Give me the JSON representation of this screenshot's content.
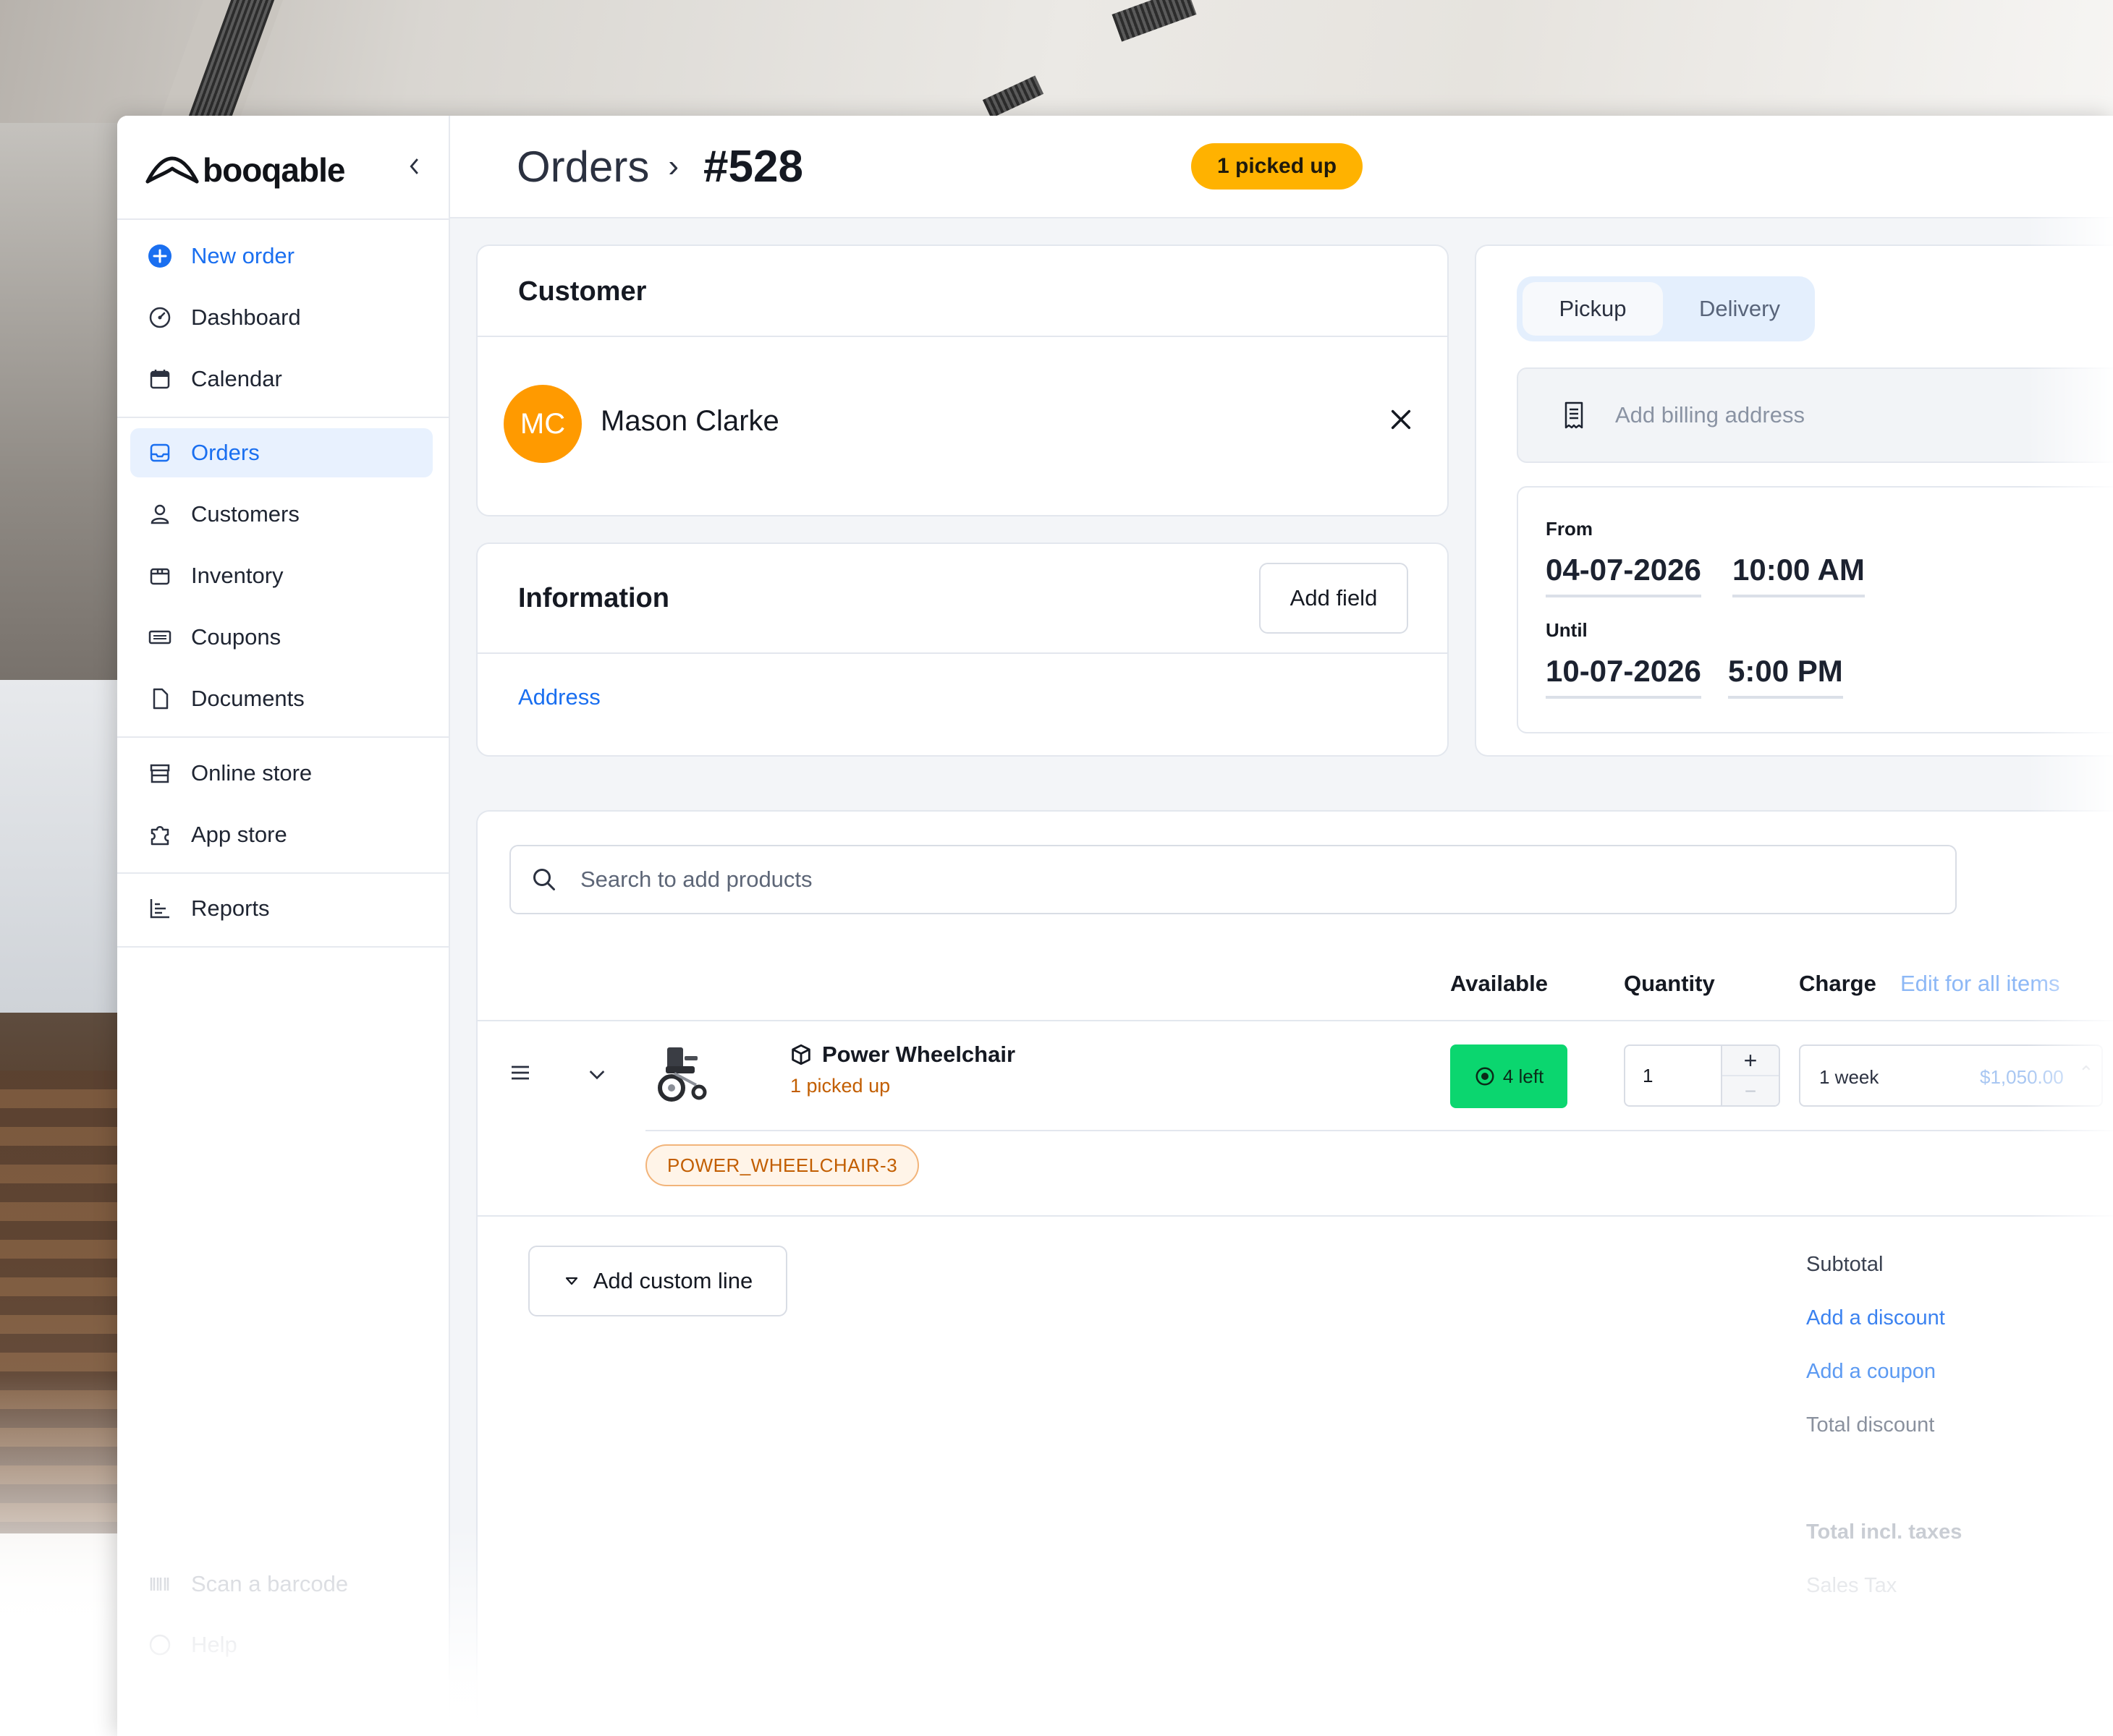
{
  "app": {
    "logo_text": "booqable"
  },
  "sidebar": {
    "new_order": "New order",
    "items": [
      {
        "label": "Dashboard",
        "icon": "dashboard-icon"
      },
      {
        "label": "Calendar",
        "icon": "calendar-icon"
      },
      {
        "label": "Orders",
        "icon": "inbox-icon",
        "active": true
      },
      {
        "label": "Customers",
        "icon": "user-icon"
      },
      {
        "label": "Inventory",
        "icon": "box-icon"
      },
      {
        "label": "Coupons",
        "icon": "ticket-icon"
      },
      {
        "label": "Documents",
        "icon": "document-icon"
      },
      {
        "label": "Online store",
        "icon": "store-icon"
      },
      {
        "label": "App store",
        "icon": "puzzle-icon"
      },
      {
        "label": "Reports",
        "icon": "chart-icon"
      }
    ],
    "footer": {
      "scan": "Scan a barcode",
      "help": "Help"
    }
  },
  "header": {
    "crumb_root": "Orders",
    "separator": "›",
    "order_number": "#528",
    "status": "1 picked up"
  },
  "customer": {
    "title": "Customer",
    "initials": "MC",
    "name": "Mason Clarke"
  },
  "information": {
    "title": "Information",
    "add_field": "Add field",
    "address_link": "Address"
  },
  "fulfillment": {
    "tabs": [
      "Pickup",
      "Delivery"
    ],
    "selected": "Pickup",
    "billing_placeholder": "Add billing address",
    "from_label": "From",
    "from_date": "04-07-2026",
    "from_time": "10:00 AM",
    "until_label": "Until",
    "until_date": "10-07-2026",
    "until_time": "5:00 PM"
  },
  "products": {
    "search_placeholder": "Search to add products",
    "columns": {
      "available": "Available",
      "quantity": "Quantity",
      "charge": "Charge",
      "edit_all": "Edit for all items"
    },
    "line": {
      "name": "Power Wheelchair",
      "status": "1 picked up",
      "available": "4 left",
      "quantity": "1",
      "plus": "+",
      "minus": "−",
      "period": "1 week",
      "price": "$1,050.00",
      "identifier": "POWER_WHEELCHAIR-3"
    },
    "add_custom_line": "Add custom line"
  },
  "summary": {
    "subtotal": "Subtotal",
    "add_discount": "Add a discount",
    "add_coupon": "Add a coupon",
    "total_discount": "Total discount",
    "total_incl_taxes": "Total incl. taxes",
    "sales_tax": "Sales Tax"
  },
  "colors": {
    "accent": "#1a6ff0",
    "status": "#ffb200",
    "available": "#0bd66f",
    "avatar": "#ff9a00"
  }
}
